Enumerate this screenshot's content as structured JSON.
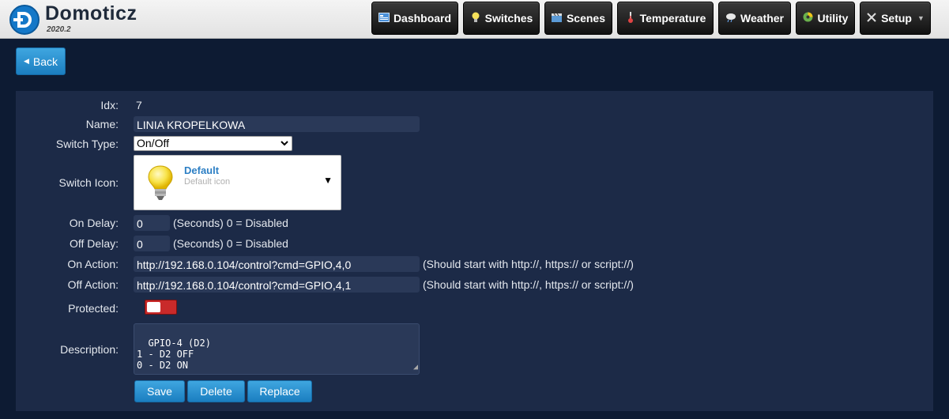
{
  "header": {
    "brand": "Domoticz",
    "version": "2020.2",
    "nav": [
      {
        "label": "Dashboard",
        "icon": "dashboard-icon"
      },
      {
        "label": "Switches",
        "icon": "lightbulb-icon"
      },
      {
        "label": "Scenes",
        "icon": "clapperboard-icon"
      },
      {
        "label": "Temperature",
        "icon": "thermometer-icon"
      },
      {
        "label": "Weather",
        "icon": "weather-icon"
      },
      {
        "label": "Utility",
        "icon": "utility-icon"
      },
      {
        "label": "Setup",
        "icon": "tools-icon"
      }
    ]
  },
  "back_label": "Back",
  "form": {
    "idx_label": "Idx:",
    "idx_value": "7",
    "name_label": "Name:",
    "name_value": "LINIA KROPELKOWA",
    "switch_type_label": "Switch Type:",
    "switch_type_value": "On/Off",
    "switch_icon_label": "Switch Icon:",
    "icon_title": "Default",
    "icon_subtitle": "Default icon",
    "on_delay_label": "On Delay:",
    "on_delay_value": "0",
    "off_delay_label": "Off Delay:",
    "off_delay_value": "0",
    "delay_hint": "(Seconds) 0 = Disabled",
    "on_action_label": "On Action:",
    "on_action_value": "http://192.168.0.104/control?cmd=GPIO,4,0",
    "off_action_label": "Off Action:",
    "off_action_value": "http://192.168.0.104/control?cmd=GPIO,4,1",
    "action_hint": "(Should start with http://, https:// or script://)",
    "protected_label": "Protected:",
    "protected_on": true,
    "description_label": "Description:",
    "description_value": "GPIO-4 (D2)\n1 - D2 OFF\n0 - D2 ON"
  },
  "buttons": {
    "save": "Save",
    "delete": "Delete",
    "replace": "Replace"
  },
  "colors": {
    "background": "#0d1b33",
    "panel": "#1c2a47",
    "accent": "#1b7ec0",
    "toggle": "#c92a2a"
  }
}
